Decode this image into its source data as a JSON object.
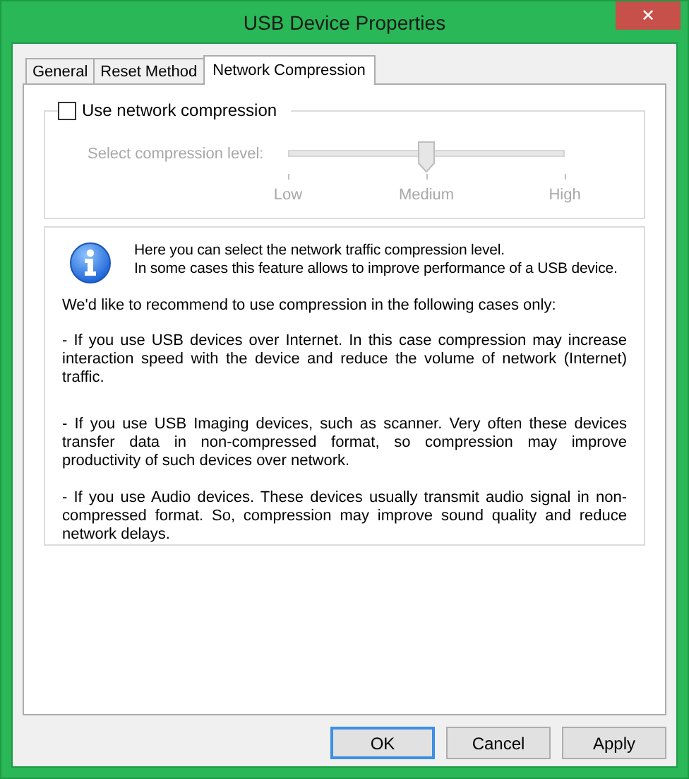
{
  "window": {
    "title": "USB Device Properties",
    "close": "✕"
  },
  "tabs": [
    {
      "label": "General",
      "selected": false
    },
    {
      "label": "Reset Method",
      "selected": false
    },
    {
      "label": "Network Compression",
      "selected": true
    }
  ],
  "compression": {
    "label": "Use network compression",
    "checked": false,
    "disabled": true,
    "level_label": "Select compression level:",
    "level": 0.5,
    "ticks": [
      "Low",
      "Medium",
      "High"
    ]
  },
  "info": {
    "intro": [
      "Here you can select the network traffic compression level.",
      "In some cases this feature allows to improve performance of a USB device."
    ],
    "recommend": "We'd like to recommend to use compression in the following cases only:",
    "cases": [
      "- If you use USB devices over Internet. In this case compression may increase interaction speed with the device and reduce the volume of network (Internet) traffic.",
      "- If you use USB Imaging devices, such as scanner. Very often these devices transfer data in non-compressed format, so compression may improve productivity of such devices over network.",
      "- If you use Audio devices. These devices usually transmit audio signal in non-compressed format. So, compression may improve sound quality and reduce network delays."
    ]
  },
  "buttons": [
    {
      "label": "OK",
      "default": true
    },
    {
      "label": "Cancel",
      "default": false
    },
    {
      "label": "Apply",
      "default": false
    }
  ]
}
